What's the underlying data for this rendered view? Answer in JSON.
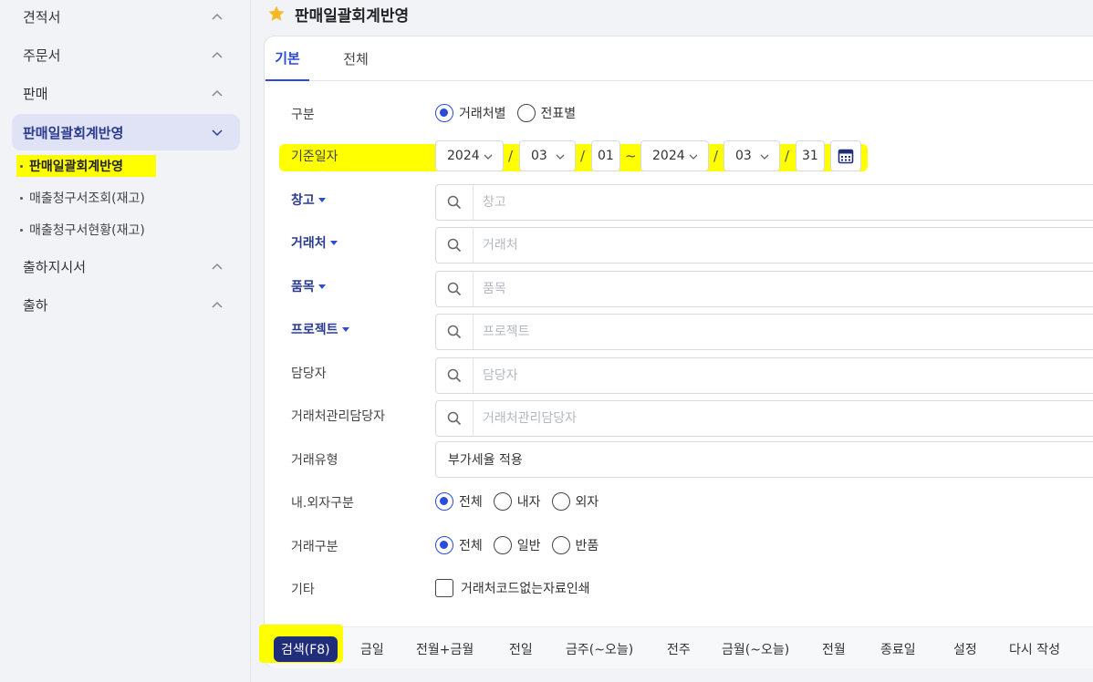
{
  "sidebar": {
    "items": [
      {
        "label": "견적서"
      },
      {
        "label": "주문서"
      },
      {
        "label": "판매"
      },
      {
        "label": "판매일괄회계반영"
      },
      {
        "label": "출하지시서"
      },
      {
        "label": "출하"
      }
    ],
    "subitems": [
      {
        "label": "판매일괄회계반영"
      },
      {
        "label": "매출청구서조회(재고)"
      },
      {
        "label": "매출청구서현황(재고)"
      }
    ]
  },
  "header": {
    "title": "판매일괄회계반영"
  },
  "tabs": [
    {
      "label": "기본"
    },
    {
      "label": "전체"
    }
  ],
  "form": {
    "type": {
      "label": "구분",
      "options": [
        "거래처별",
        "전표별"
      ],
      "selected": "거래처별"
    },
    "date": {
      "label": "기준일자",
      "from_year": "2024",
      "from_month": "03",
      "from_day": "01",
      "tilde": "~",
      "to_year": "2024",
      "to_month": "03",
      "to_day": "31",
      "slash": "/"
    },
    "warehouse": {
      "label": "창고",
      "placeholder": "창고"
    },
    "customer": {
      "label": "거래처",
      "placeholder": "거래처"
    },
    "item": {
      "label": "품목",
      "placeholder": "품목"
    },
    "project": {
      "label": "프로젝트",
      "placeholder": "프로젝트"
    },
    "manager": {
      "label": "담당자",
      "placeholder": "담당자"
    },
    "customer_manager": {
      "label": "거래처관리담당자",
      "placeholder": "거래처관리담당자"
    },
    "trade_type": {
      "label": "거래유형",
      "value": "부가세율 적용"
    },
    "inout": {
      "label": "내.외자구분",
      "options": [
        "전체",
        "내자",
        "외자"
      ],
      "selected": "전체"
    },
    "trade_kind": {
      "label": "거래구분",
      "options": [
        "전체",
        "일반",
        "반품"
      ],
      "selected": "전체"
    },
    "etc": {
      "label": "기타",
      "checkbox_label": "거래처코드없는자료인쇄",
      "checked": false
    }
  },
  "bottom_bar": {
    "buttons": [
      {
        "label": "검색(F8)"
      },
      {
        "label": "금일"
      },
      {
        "label": "전월+금월"
      },
      {
        "label": "전일"
      },
      {
        "label": "금주(~오늘)"
      },
      {
        "label": "전주"
      },
      {
        "label": "금월(~오늘)"
      },
      {
        "label": "전월"
      },
      {
        "label": "종료일"
      },
      {
        "label": "설정"
      },
      {
        "label": "다시 작성"
      }
    ]
  },
  "colors": {
    "accent": "#2b4bd8",
    "primary_button": "#1f2d7a",
    "highlight": "#ffff00",
    "star": "#f5b925"
  }
}
